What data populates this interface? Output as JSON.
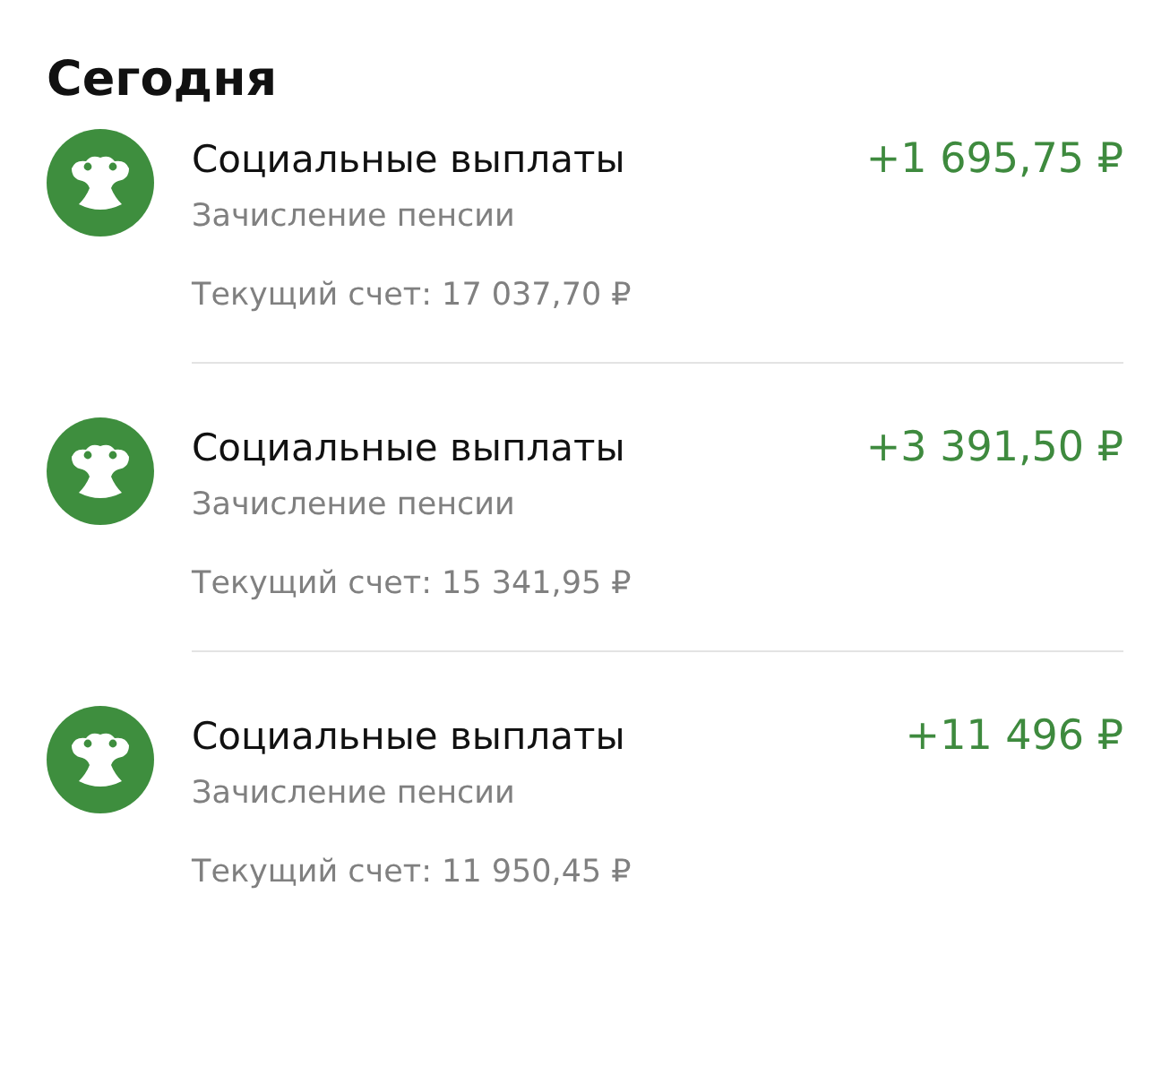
{
  "section_title": "Сегодня",
  "transactions": [
    {
      "title": "Социальные выплаты",
      "subtitle": "Зачисление пенсии",
      "balance": "Текущий счет: 17 037,70 ₽",
      "amount": "+1 695,75 ₽"
    },
    {
      "title": "Социальные выплаты",
      "subtitle": "Зачисление пенсии",
      "balance": "Текущий счет: 15 341,95 ₽",
      "amount": "+3 391,50 ₽"
    },
    {
      "title": "Социальные выплаты",
      "subtitle": "Зачисление пенсии",
      "balance": "Текущий счет: 11 950,45 ₽",
      "amount": "+11 496 ₽"
    }
  ]
}
